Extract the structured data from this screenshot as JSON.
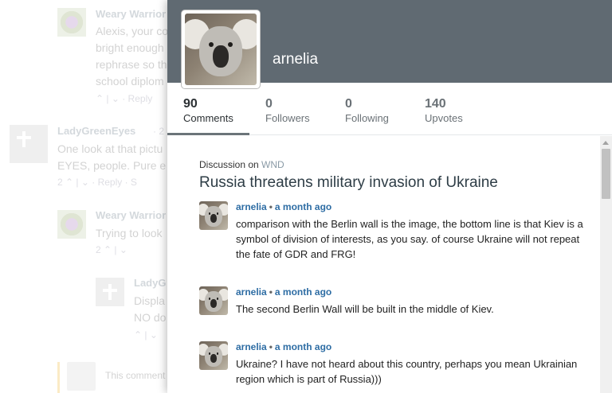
{
  "background_thread": {
    "comments": [
      {
        "name": "Weary Warrior",
        "lines": [
          "Alexis, your co",
          "bright enough",
          "rephrase so th",
          "school diplom"
        ],
        "meta": "⌃ | ⌄ · Reply"
      },
      {
        "name": "LadyGreenEyes",
        "time": "· 2",
        "lines": [
          "One look at that pictu",
          "EYES, people. Pure e"
        ],
        "meta": "2 ⌃ | ⌄ · Reply · S"
      },
      {
        "name": "Weary Warrior",
        "lines": [
          "Trying to look"
        ],
        "meta": "2 ⌃ | ⌄"
      },
      {
        "name": "LadyG",
        "lines": [
          "Displa",
          "NO do"
        ],
        "meta": "⌃ | ⌄"
      },
      {
        "placeholder": "This comment"
      }
    ]
  },
  "profile": {
    "username": "arnelia",
    "stats": [
      {
        "value": "90",
        "label": "Comments",
        "active": true
      },
      {
        "value": "0",
        "label": "Followers",
        "active": false
      },
      {
        "value": "0",
        "label": "Following",
        "active": false
      },
      {
        "value": "140",
        "label": "Upvotes",
        "active": false
      }
    ]
  },
  "discussion": {
    "prefix": "Discussion on",
    "site": "WND",
    "title": "Russia threatens military invasion of Ukraine"
  },
  "comments": [
    {
      "author": "arnelia",
      "separator": "•",
      "time": "a month ago",
      "text": "comparison with the Berlin wall is the image, the bottom line is that Kiev is a symbol of division of interests, as you say. of course Ukraine will not repeat the fate of GDR and FRG!"
    },
    {
      "author": "arnelia",
      "separator": "•",
      "time": "a month ago",
      "text": "The second Berlin Wall will be built in the middle of Kiev."
    },
    {
      "author": "arnelia",
      "separator": "•",
      "time": "a month ago",
      "text": "Ukraine? I have not heard about this country, perhaps you mean Ukrainian region which is part of Russia)))"
    }
  ],
  "colors": {
    "banner": "#606a72",
    "link": "#2e6da4",
    "title": "#2e3d46"
  }
}
